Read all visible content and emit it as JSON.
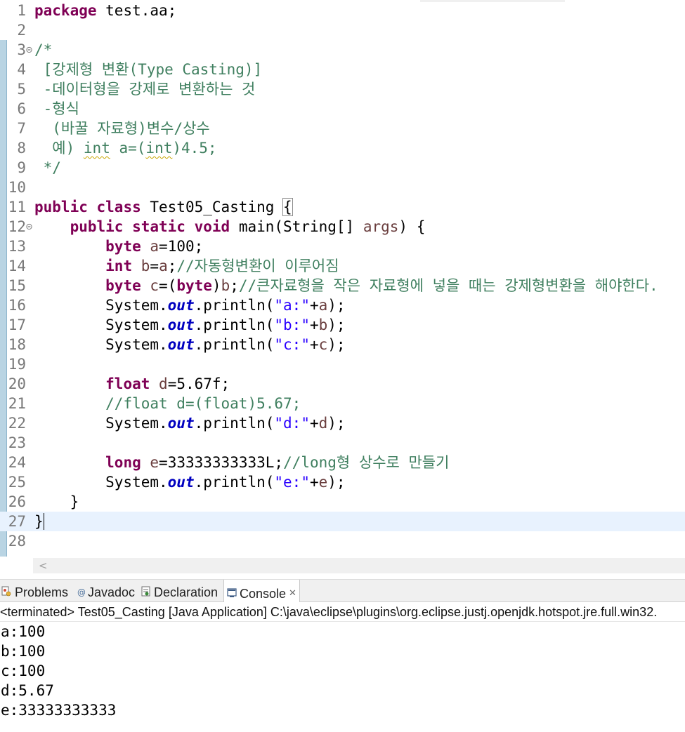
{
  "editor": {
    "lines": [
      {
        "num": "1",
        "tokens": [
          {
            "t": "kw",
            "v": "package"
          },
          {
            "t": "plain",
            "v": " test.aa;"
          }
        ]
      },
      {
        "num": "2",
        "tokens": []
      },
      {
        "num": "3",
        "fold": true,
        "tokens": [
          {
            "t": "cm",
            "v": "/*"
          }
        ]
      },
      {
        "num": "4",
        "tokens": [
          {
            "t": "cm",
            "v": " [강제형 변환(Type Casting)]"
          }
        ]
      },
      {
        "num": "5",
        "tokens": [
          {
            "t": "cm",
            "v": " -데이터형을 강제로 변환하는 것"
          }
        ]
      },
      {
        "num": "6",
        "tokens": [
          {
            "t": "cm",
            "v": " -형식"
          }
        ]
      },
      {
        "num": "7",
        "tokens": [
          {
            "t": "cm",
            "v": "  (바꿀 자료형)변수/상수"
          }
        ]
      },
      {
        "num": "8",
        "tokens": [
          {
            "t": "cm",
            "v": "  예) "
          },
          {
            "t": "cm squiggle",
            "v": "int"
          },
          {
            "t": "cm",
            "v": " a=("
          },
          {
            "t": "cm squiggle",
            "v": "int"
          },
          {
            "t": "cm",
            "v": ")4.5;"
          }
        ]
      },
      {
        "num": "9",
        "tokens": [
          {
            "t": "cm",
            "v": " */"
          }
        ]
      },
      {
        "num": "10",
        "tokens": []
      },
      {
        "num": "11",
        "tokens": [
          {
            "t": "kw",
            "v": "public"
          },
          {
            "t": "plain",
            "v": " "
          },
          {
            "t": "kw",
            "v": "class"
          },
          {
            "t": "plain",
            "v": " Test05_Casting "
          },
          {
            "t": "plain caret-bracket",
            "v": "{"
          }
        ]
      },
      {
        "num": "12",
        "fold": true,
        "tokens": [
          {
            "t": "plain",
            "v": "    "
          },
          {
            "t": "kw",
            "v": "public"
          },
          {
            "t": "plain",
            "v": " "
          },
          {
            "t": "kw",
            "v": "static"
          },
          {
            "t": "plain",
            "v": " "
          },
          {
            "t": "kw",
            "v": "void"
          },
          {
            "t": "plain",
            "v": " main(String[] "
          },
          {
            "t": "var",
            "v": "args"
          },
          {
            "t": "plain",
            "v": ") {"
          }
        ]
      },
      {
        "num": "13",
        "tokens": [
          {
            "t": "plain",
            "v": "        "
          },
          {
            "t": "kw",
            "v": "byte"
          },
          {
            "t": "plain",
            "v": " "
          },
          {
            "t": "var",
            "v": "a"
          },
          {
            "t": "plain",
            "v": "=100;"
          }
        ]
      },
      {
        "num": "14",
        "tokens": [
          {
            "t": "plain",
            "v": "        "
          },
          {
            "t": "kw",
            "v": "int"
          },
          {
            "t": "plain",
            "v": " "
          },
          {
            "t": "var",
            "v": "b"
          },
          {
            "t": "plain",
            "v": "="
          },
          {
            "t": "var",
            "v": "a"
          },
          {
            "t": "plain",
            "v": ";"
          },
          {
            "t": "cm",
            "v": "//자동형변환이 이루어짐"
          }
        ]
      },
      {
        "num": "15",
        "tokens": [
          {
            "t": "plain",
            "v": "        "
          },
          {
            "t": "kw",
            "v": "byte"
          },
          {
            "t": "plain",
            "v": " "
          },
          {
            "t": "var",
            "v": "c"
          },
          {
            "t": "plain",
            "v": "=("
          },
          {
            "t": "kw",
            "v": "byte"
          },
          {
            "t": "plain",
            "v": ")"
          },
          {
            "t": "var",
            "v": "b"
          },
          {
            "t": "plain",
            "v": ";"
          },
          {
            "t": "cm",
            "v": "//큰자료형을 작은 자료형에 넣을 때는 강제형변환을 해야한다."
          }
        ]
      },
      {
        "num": "16",
        "tokens": [
          {
            "t": "plain",
            "v": "        System."
          },
          {
            "t": "fld",
            "v": "out"
          },
          {
            "t": "plain",
            "v": ".println("
          },
          {
            "t": "str",
            "v": "\"a:\""
          },
          {
            "t": "plain",
            "v": "+"
          },
          {
            "t": "var",
            "v": "a"
          },
          {
            "t": "plain",
            "v": ");"
          }
        ]
      },
      {
        "num": "17",
        "tokens": [
          {
            "t": "plain",
            "v": "        System."
          },
          {
            "t": "fld",
            "v": "out"
          },
          {
            "t": "plain",
            "v": ".println("
          },
          {
            "t": "str",
            "v": "\"b:\""
          },
          {
            "t": "plain",
            "v": "+"
          },
          {
            "t": "var",
            "v": "b"
          },
          {
            "t": "plain",
            "v": ");"
          }
        ]
      },
      {
        "num": "18",
        "tokens": [
          {
            "t": "plain",
            "v": "        System."
          },
          {
            "t": "fld",
            "v": "out"
          },
          {
            "t": "plain",
            "v": ".println("
          },
          {
            "t": "str",
            "v": "\"c:\""
          },
          {
            "t": "plain",
            "v": "+"
          },
          {
            "t": "var",
            "v": "c"
          },
          {
            "t": "plain",
            "v": ");"
          }
        ]
      },
      {
        "num": "19",
        "tokens": []
      },
      {
        "num": "20",
        "tokens": [
          {
            "t": "plain",
            "v": "        "
          },
          {
            "t": "kw",
            "v": "float"
          },
          {
            "t": "plain",
            "v": " "
          },
          {
            "t": "var",
            "v": "d"
          },
          {
            "t": "plain",
            "v": "=5.67f;"
          }
        ]
      },
      {
        "num": "21",
        "tokens": [
          {
            "t": "plain",
            "v": "        "
          },
          {
            "t": "cm",
            "v": "//float d=(float)5.67;"
          }
        ]
      },
      {
        "num": "22",
        "tokens": [
          {
            "t": "plain",
            "v": "        System."
          },
          {
            "t": "fld",
            "v": "out"
          },
          {
            "t": "plain",
            "v": ".println("
          },
          {
            "t": "str",
            "v": "\"d:\""
          },
          {
            "t": "plain",
            "v": "+"
          },
          {
            "t": "var",
            "v": "d"
          },
          {
            "t": "plain",
            "v": ");"
          }
        ]
      },
      {
        "num": "23",
        "tokens": []
      },
      {
        "num": "24",
        "tokens": [
          {
            "t": "plain",
            "v": "        "
          },
          {
            "t": "kw",
            "v": "long"
          },
          {
            "t": "plain",
            "v": " "
          },
          {
            "t": "var",
            "v": "e"
          },
          {
            "t": "plain",
            "v": "=33333333333L;"
          },
          {
            "t": "cm",
            "v": "//long형 상수로 만들기"
          }
        ]
      },
      {
        "num": "25",
        "tokens": [
          {
            "t": "plain",
            "v": "        System."
          },
          {
            "t": "fld",
            "v": "out"
          },
          {
            "t": "plain",
            "v": ".println("
          },
          {
            "t": "str",
            "v": "\"e:\""
          },
          {
            "t": "plain",
            "v": "+"
          },
          {
            "t": "var",
            "v": "e"
          },
          {
            "t": "plain",
            "v": ");"
          }
        ]
      },
      {
        "num": "26",
        "tokens": [
          {
            "t": "plain",
            "v": "    }"
          }
        ]
      },
      {
        "num": "27",
        "current": true,
        "tokens": [
          {
            "t": "plain",
            "v": "}"
          }
        ]
      },
      {
        "num": "28",
        "tokens": []
      }
    ],
    "scroll_left_glyph": "<"
  },
  "console": {
    "tabs": [
      {
        "label": "Problems",
        "icon": "problems-icon"
      },
      {
        "label": "Javadoc",
        "icon": "javadoc-icon"
      },
      {
        "label": "Declaration",
        "icon": "declaration-icon"
      },
      {
        "label": "Console",
        "icon": "console-icon",
        "active": true
      }
    ],
    "close_glyph": "✕",
    "status": "<terminated> Test05_Casting [Java Application] C:\\java\\eclipse\\plugins\\org.eclipse.justj.openjdk.hotspot.jre.full.win32.",
    "output": [
      "a:100",
      "b:100",
      "c:100",
      "d:5.67",
      "e:33333333333"
    ]
  },
  "colors": {
    "keyword": "#7f0055",
    "comment": "#3f7f5f",
    "string": "#2a00ff",
    "field": "#0000c0",
    "variable": "#6a3e3e",
    "current_line": "#e8f2fe",
    "change_bar": "#b9d4e3"
  }
}
